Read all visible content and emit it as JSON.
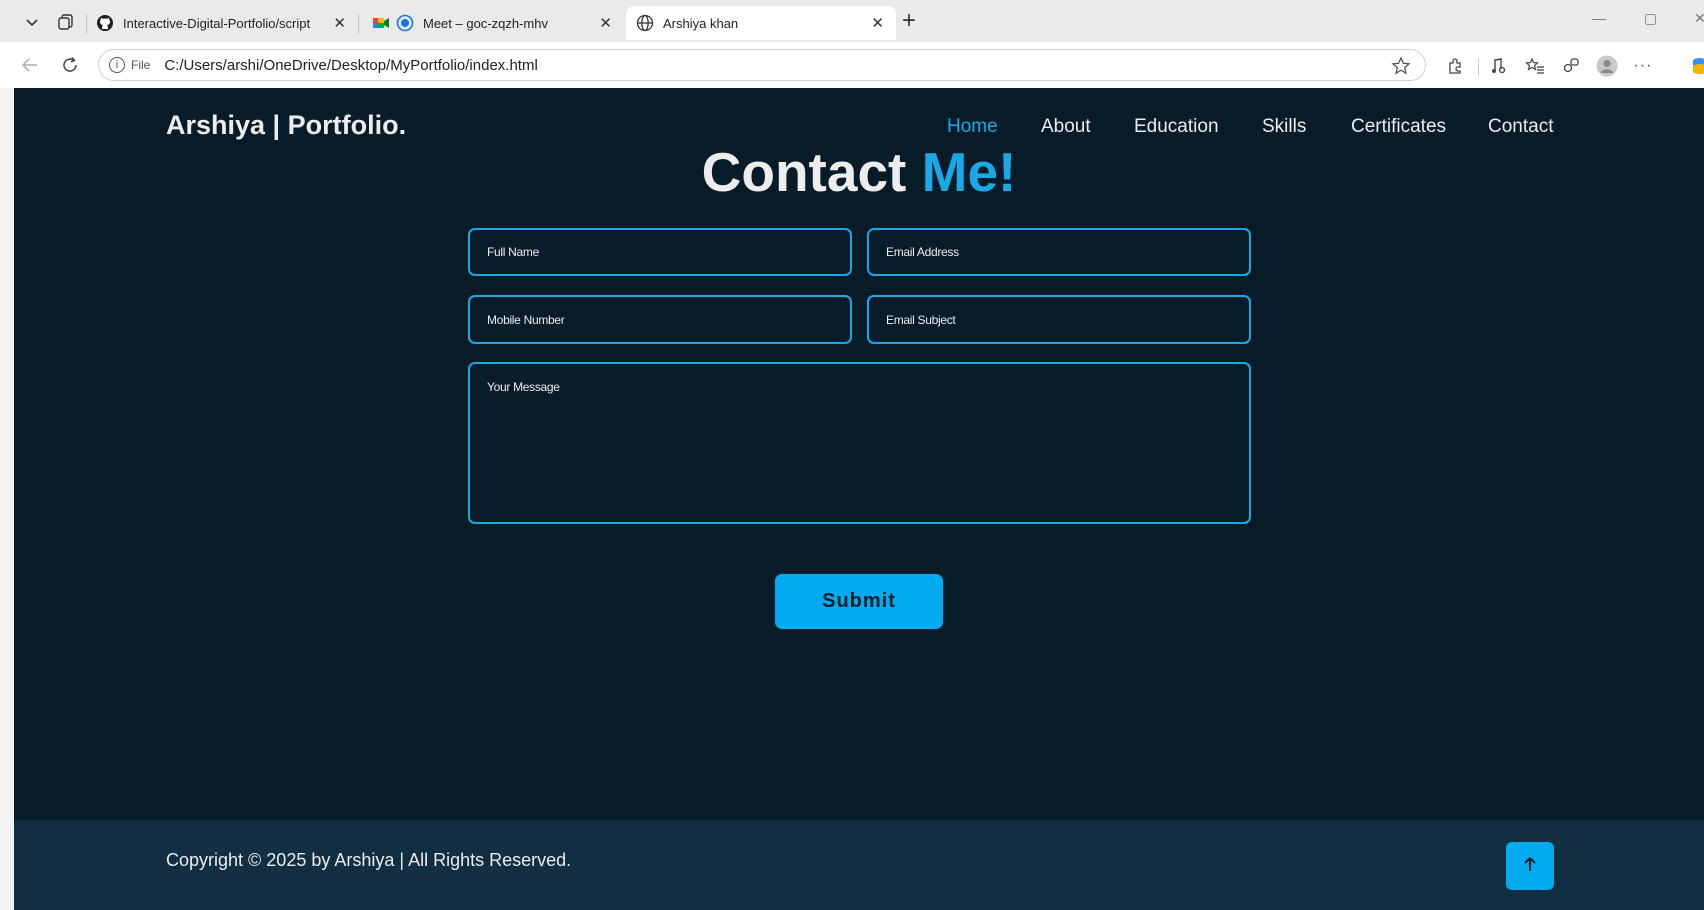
{
  "browser": {
    "tabs": [
      {
        "label": "Interactive-Digital-Portfolio/script",
        "icon": "github-icon"
      },
      {
        "label": "Meet – goc-zqzh-mhv",
        "icon": "google-meet-icon"
      },
      {
        "label": "Arshiya khan",
        "icon": "globe-icon"
      }
    ],
    "new_tab_label": "+",
    "address": {
      "scheme_label": "File",
      "url": "C:/Users/arshi/OneDrive/Desktop/MyPortfolio/index.html"
    },
    "more_label": "···"
  },
  "site": {
    "logo": "Arshiya | Portfolio.",
    "nav": [
      "Home",
      "About",
      "Education",
      "Skills",
      "Certificates",
      "Contact"
    ],
    "active_nav": "Home",
    "accent_color": "#00abf0",
    "background_color": "#081b29"
  },
  "contact": {
    "heading_main": "Contact",
    "heading_accent": "Me!",
    "fields": {
      "full_name": "Full Name",
      "email_address": "Email Address",
      "mobile_number": "Mobile Number",
      "email_subject": "Email Subject",
      "message": "Your Message"
    },
    "submit_label": "Submit"
  },
  "footer": {
    "copyright": "Copyright © 2025 by Arshiya | All Rights Reserved.",
    "scroll_top_icon": "arrow-up-icon"
  }
}
